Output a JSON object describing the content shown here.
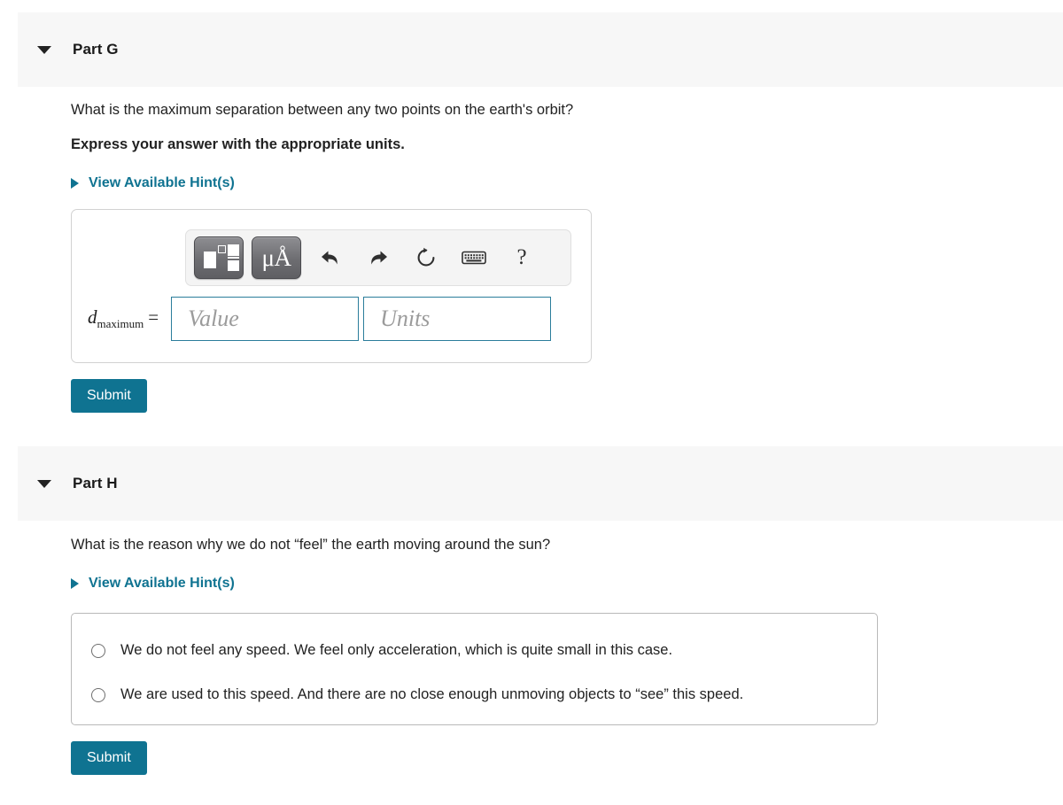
{
  "parts": [
    {
      "id": "G",
      "title": "Part G",
      "collapse_icon": "caret-down-icon",
      "question": "What is the maximum separation between any two points on the earth's orbit?",
      "instruction": "Express your answer with the appropriate units.",
      "hints_label": "View Available Hint(s)",
      "hints_icon": "caret-right-icon",
      "answer": {
        "label_variable": "d",
        "label_subscript": "maximum",
        "label_equals": "=",
        "value_placeholder": "Value",
        "units_placeholder": "Units",
        "value_text": "",
        "units_text": "",
        "toolbar": [
          {
            "name": "template-icon",
            "glyph": "",
            "style": "dark"
          },
          {
            "name": "mu-angstrom-icon",
            "glyph": "μÅ",
            "style": "dark"
          },
          {
            "name": "undo-icon",
            "glyph": "↶",
            "style": "plain"
          },
          {
            "name": "redo-icon",
            "glyph": "↷",
            "style": "plain"
          },
          {
            "name": "reset-icon",
            "glyph": "↻",
            "style": "plain"
          },
          {
            "name": "keyboard-icon",
            "glyph": "⌨",
            "style": "plain"
          },
          {
            "name": "help-icon",
            "glyph": "?",
            "style": "plain"
          }
        ]
      },
      "submit_label": "Submit"
    },
    {
      "id": "H",
      "title": "Part H",
      "collapse_icon": "caret-down-icon",
      "question": "What is the reason why we do not “feel” the earth moving around the sun?",
      "hints_label": "View Available Hint(s)",
      "hints_icon": "caret-right-icon",
      "choices": [
        {
          "selected": false,
          "label": "We do not feel any speed. We feel only acceleration, which is quite small in this case."
        },
        {
          "selected": false,
          "label": "We are used to this speed. And there are no close enough unmoving objects to “see” this speed."
        }
      ],
      "submit_label": "Submit"
    }
  ],
  "colors": {
    "accent": "#0f7391",
    "header_bg": "#f7f7f7",
    "field_border": "#2b7d9b",
    "text": "#222222"
  }
}
